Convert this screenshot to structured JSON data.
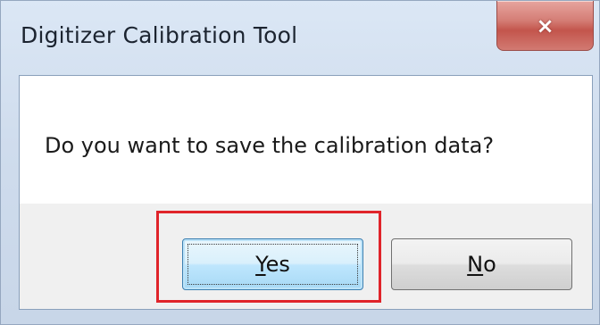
{
  "window": {
    "title": "Digitizer Calibration Tool",
    "close_icon": "close-icon",
    "close_glyph": "×"
  },
  "message": {
    "text": "Do you want to save the calibration data?"
  },
  "buttons": {
    "yes": {
      "accel": "Y",
      "rest": "es"
    },
    "no": {
      "accel": "N",
      "rest": "o"
    }
  },
  "colors": {
    "highlight": "#e0242a",
    "close_button": "#c3554c",
    "default_button_border": "#3c7fb1"
  }
}
